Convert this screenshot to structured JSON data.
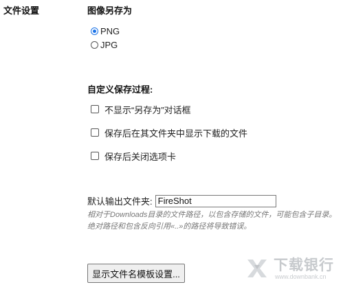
{
  "sidebar": {
    "section_label": "文件设置"
  },
  "save_as": {
    "title": "图像另存为",
    "options": [
      {
        "label": "PNG",
        "checked": true
      },
      {
        "label": "JPG",
        "checked": false
      }
    ]
  },
  "custom_save": {
    "title": "自定义保存过程:",
    "options": [
      {
        "label": "不显示“另存为”对话框",
        "checked": false
      },
      {
        "label": "保存后在其文件夹中显示下载的文件",
        "checked": false
      },
      {
        "label": "保存后关闭选项卡",
        "checked": false
      }
    ]
  },
  "output_folder": {
    "label": "默认输出文件夹:",
    "value": "FireShot",
    "hint_line1": "相对于Downloads目录的文件路径，以包含存储的文件，可能包含子目录。",
    "hint_line2": "绝对路径和包含反向引用«..»的路径将导致错误。"
  },
  "template_button": {
    "label": "显示文件名模板设置..."
  },
  "watermark": {
    "title": "下载银行",
    "url": "www.downbank.cn"
  },
  "colors": {
    "accent": "#1a73e8",
    "hint_text": "#777777",
    "button_bg": "#efefef"
  }
}
